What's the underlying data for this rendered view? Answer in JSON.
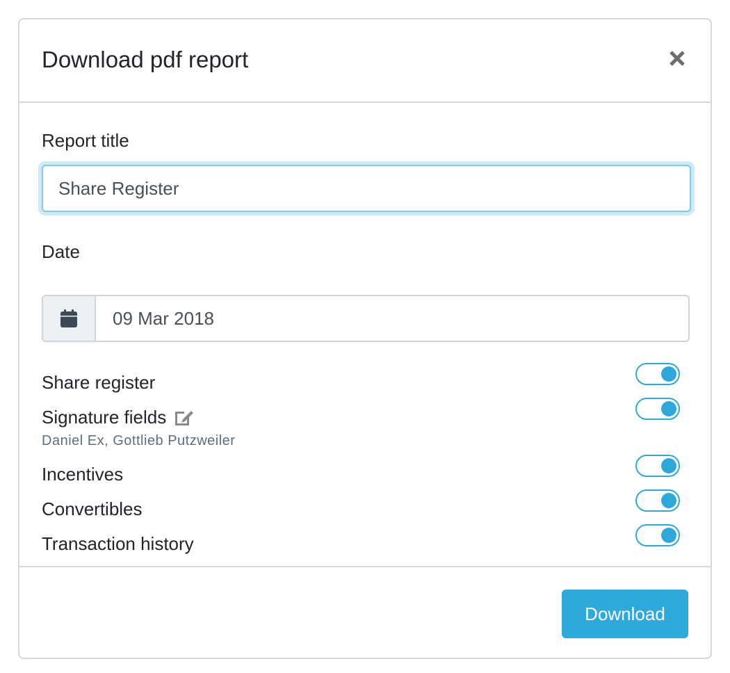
{
  "modal": {
    "title": "Download pdf report",
    "close_icon": "close-icon"
  },
  "report_title": {
    "label": "Report title",
    "value": "Share Register"
  },
  "date": {
    "label": "Date",
    "icon": "calendar-icon",
    "value": "09 Mar 2018"
  },
  "options": [
    {
      "label": "Share register",
      "enabled": true
    },
    {
      "label": "Signature fields",
      "enabled": true,
      "edit_icon": "edit-icon",
      "sub": "Daniel Ex, Gottlieb Putzweiler"
    },
    {
      "label": "Incentives",
      "enabled": true
    },
    {
      "label": "Convertibles",
      "enabled": true
    },
    {
      "label": "Transaction history",
      "enabled": true
    }
  ],
  "footer": {
    "download_label": "Download"
  },
  "colors": {
    "accent": "#2fa9d9",
    "focus_ring": "#cdeaf7",
    "border": "#d4d7db",
    "addon_bg": "#eef1f4",
    "subtext": "#5d6f7d"
  }
}
